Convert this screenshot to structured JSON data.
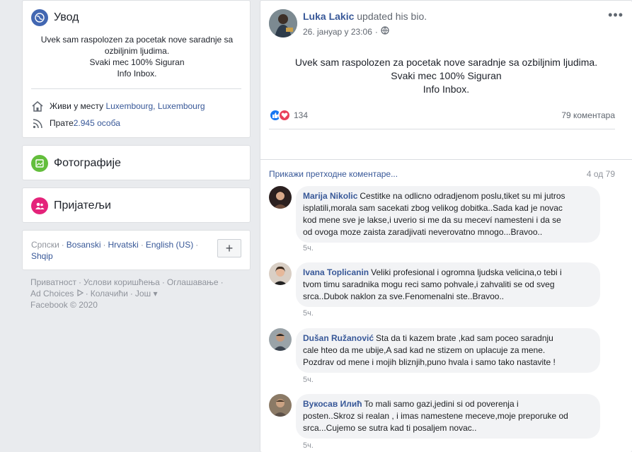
{
  "intro": {
    "title": "Увод",
    "bio_lines": [
      "Uvek sam raspolozen za pocetak nove saradnje sa",
      "ozbiljnim ljudima.",
      "Svaki mec 100% Siguran",
      "Info Inbox."
    ],
    "lives_label": "Живи у месту",
    "lives_place": "Luxembourg, Luxembourg",
    "followers_label": "Прате ",
    "followers_count": "2.945 особа"
  },
  "photos": {
    "title": "Фотографије"
  },
  "friends": {
    "title": "Пријатељи"
  },
  "languages": {
    "items": [
      "Српски",
      "Bosanski",
      "Hrvatski",
      "English (US)",
      "Shqip"
    ],
    "add_label": "+"
  },
  "footer": {
    "links": [
      "Приватност",
      "Услови коришћења",
      "Оглашавање",
      "Ad Choices",
      "Колачићи",
      "Још"
    ],
    "copyright": "Facebook © 2020"
  },
  "post": {
    "author": "Luka Lakic",
    "action": "updated his bio.",
    "date": "26. јануар у 23:06",
    "body_lines": [
      "Uvek sam raspolozen za pocetak nove saradnje sa ozbiljnim ljudima.",
      "Svaki mec 100% Siguran",
      "Info Inbox."
    ],
    "reaction_count": "134",
    "comment_count": "79 коментара",
    "prev_comments_label": "Прикажи претходне коментаре...",
    "prev_comments_count": "4 од 79",
    "more_label": "•••"
  },
  "comments": [
    {
      "name": "Marija Nikolic",
      "lines": [
        "Cestitke na odlicno odradjenom poslu,tiket su mi jutros",
        "isplatili,morala sam sacekati zbog velikog dobitka..Sada kad je novac",
        "kod mene sve je lakse,i uverio si me da su meceví namesteni i da se",
        "od ovoga moze zaista zaradjivati neverovatno mnogo...Bravoo.."
      ],
      "first_line": "Cestitke na odlicno odradjenom poslu,tiket su mi jutros",
      "time": "5ч."
    },
    {
      "name": "Ivana Toplicanin",
      "first_line": "Veliki profesional i ogromna ljudska velicina,o tebi i",
      "lines": [
        "Veliki profesional i ogromna ljudska velicina,o tebi i",
        "tvom timu saradnika mogu reci samo pohvale,i zahvaliti se od sveg",
        "srca..Dubok naklon za sve.Fenomenalni ste..Bravoo.."
      ],
      "time": "5ч."
    },
    {
      "name": "Dušan Ružanović",
      "first_line": "Sta da ti kazem brate ,kad sam poceo saradnju",
      "lines": [
        "Sta da ti kazem brate ,kad sam poceo saradnju",
        "cale hteo da me ubije,A sad kad ne stizem on uplacuje za mene.",
        "Pozdrav od mene i mojih bliznjih,puno hvala i samo tako nastavite !"
      ],
      "time": "5ч."
    },
    {
      "name": "Вукосав Илић",
      "first_line": "To mali samo gazi,jedini si od poverenja i",
      "lines": [
        "To mali samo gazi,jedini si od poverenja i",
        "posten..Skroz si realan , i imas namestene meceve,moje preporuke od",
        "srca...Cujemo se sutra kad ti posaljem novac.."
      ],
      "time": "5ч."
    }
  ],
  "colors": {
    "link": "#385898",
    "intro_icon": "#4267b2",
    "photos_icon": "#63be3c",
    "friends_icon": "#e4237a",
    "like": "#1877f2",
    "love": "#e9405a"
  }
}
